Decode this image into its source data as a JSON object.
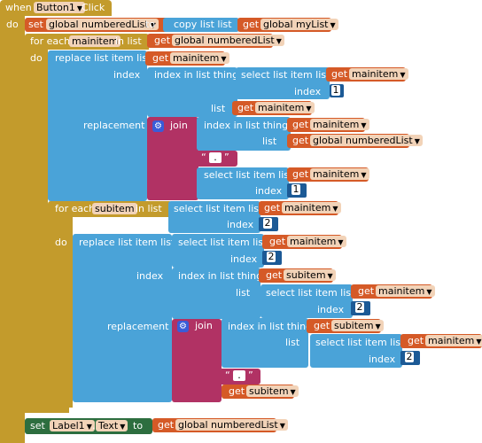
{
  "event": {
    "when": "when",
    "component": "Button1",
    "event": "Click",
    "do": "do"
  },
  "s1": {
    "set": "set",
    "var": "global numberedList",
    "to": "to",
    "copy": "copy list  list",
    "get": "get",
    "target": "global myList"
  },
  "fe1": {
    "label": "for each",
    "var": "mainitem",
    "inlist": "in list",
    "get": "get",
    "list": "global numberedList",
    "do": "do"
  },
  "r1": {
    "label": "replace list item  list",
    "get": "get",
    "var": "mainitem",
    "index": "index",
    "indexin": "index in list  thing",
    "sel": "select list item  list",
    "index2": "index",
    "idxval": "1",
    "list": "list",
    "replacement": "replacement",
    "join": "join",
    "j_idx": "index in list  thing",
    "j_list": "list",
    "j_gl": "global numberedList",
    "dot": ".",
    "sel2": "select list item  list",
    "index3": "index",
    "idxval2": "1"
  },
  "fe2": {
    "label": "for each",
    "var": "subitem",
    "inlist": "in list",
    "sel": "select list item  list",
    "get": "get",
    "mv": "mainitem",
    "index": "index",
    "idx": "2",
    "do": "do"
  },
  "r2": {
    "label": "replace list item  list",
    "sel": "select list item  list",
    "get": "get",
    "mv": "mainitem",
    "index": "index",
    "idx": "2",
    "index_lbl": "index",
    "indexin": "index in list  thing",
    "sv": "subitem",
    "list": "list",
    "sel2": "select list item  list",
    "idx2": "2",
    "replacement": "replacement",
    "join": "join",
    "j_idx": "index in list  thing",
    "j_list": "list",
    "sel3": "select list item  list",
    "idx3": "2",
    "dot": ".",
    "sub": "subitem"
  },
  "final": {
    "set": "set",
    "component": "Label1",
    "prop": "Text",
    "to": "to",
    "get": "get",
    "var": "global numberedList"
  }
}
